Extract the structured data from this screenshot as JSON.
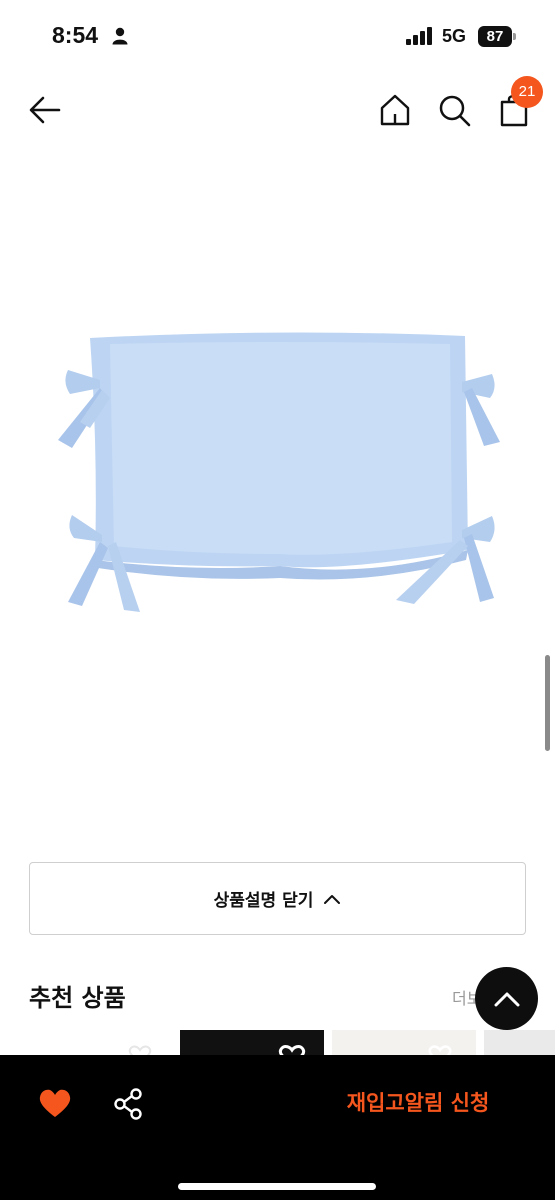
{
  "status_bar": {
    "time": "8:54",
    "network": "5G",
    "battery": "87"
  },
  "header": {
    "cart_count": "21",
    "icons": [
      "back-arrow-icon",
      "home-icon",
      "search-icon",
      "shopping-bag-icon"
    ]
  },
  "product": {
    "image": "light-blue-pillow-with-bows",
    "toggle_label": "상품설명 닫기"
  },
  "recommended": {
    "title": "추천 상품",
    "more_label": "더보"
  },
  "bottom_bar": {
    "restock_label": "재입고알림 신청"
  },
  "colors": {
    "accent": "#f4561e",
    "pillow": "#bdd5f3",
    "bar": "#000000"
  }
}
